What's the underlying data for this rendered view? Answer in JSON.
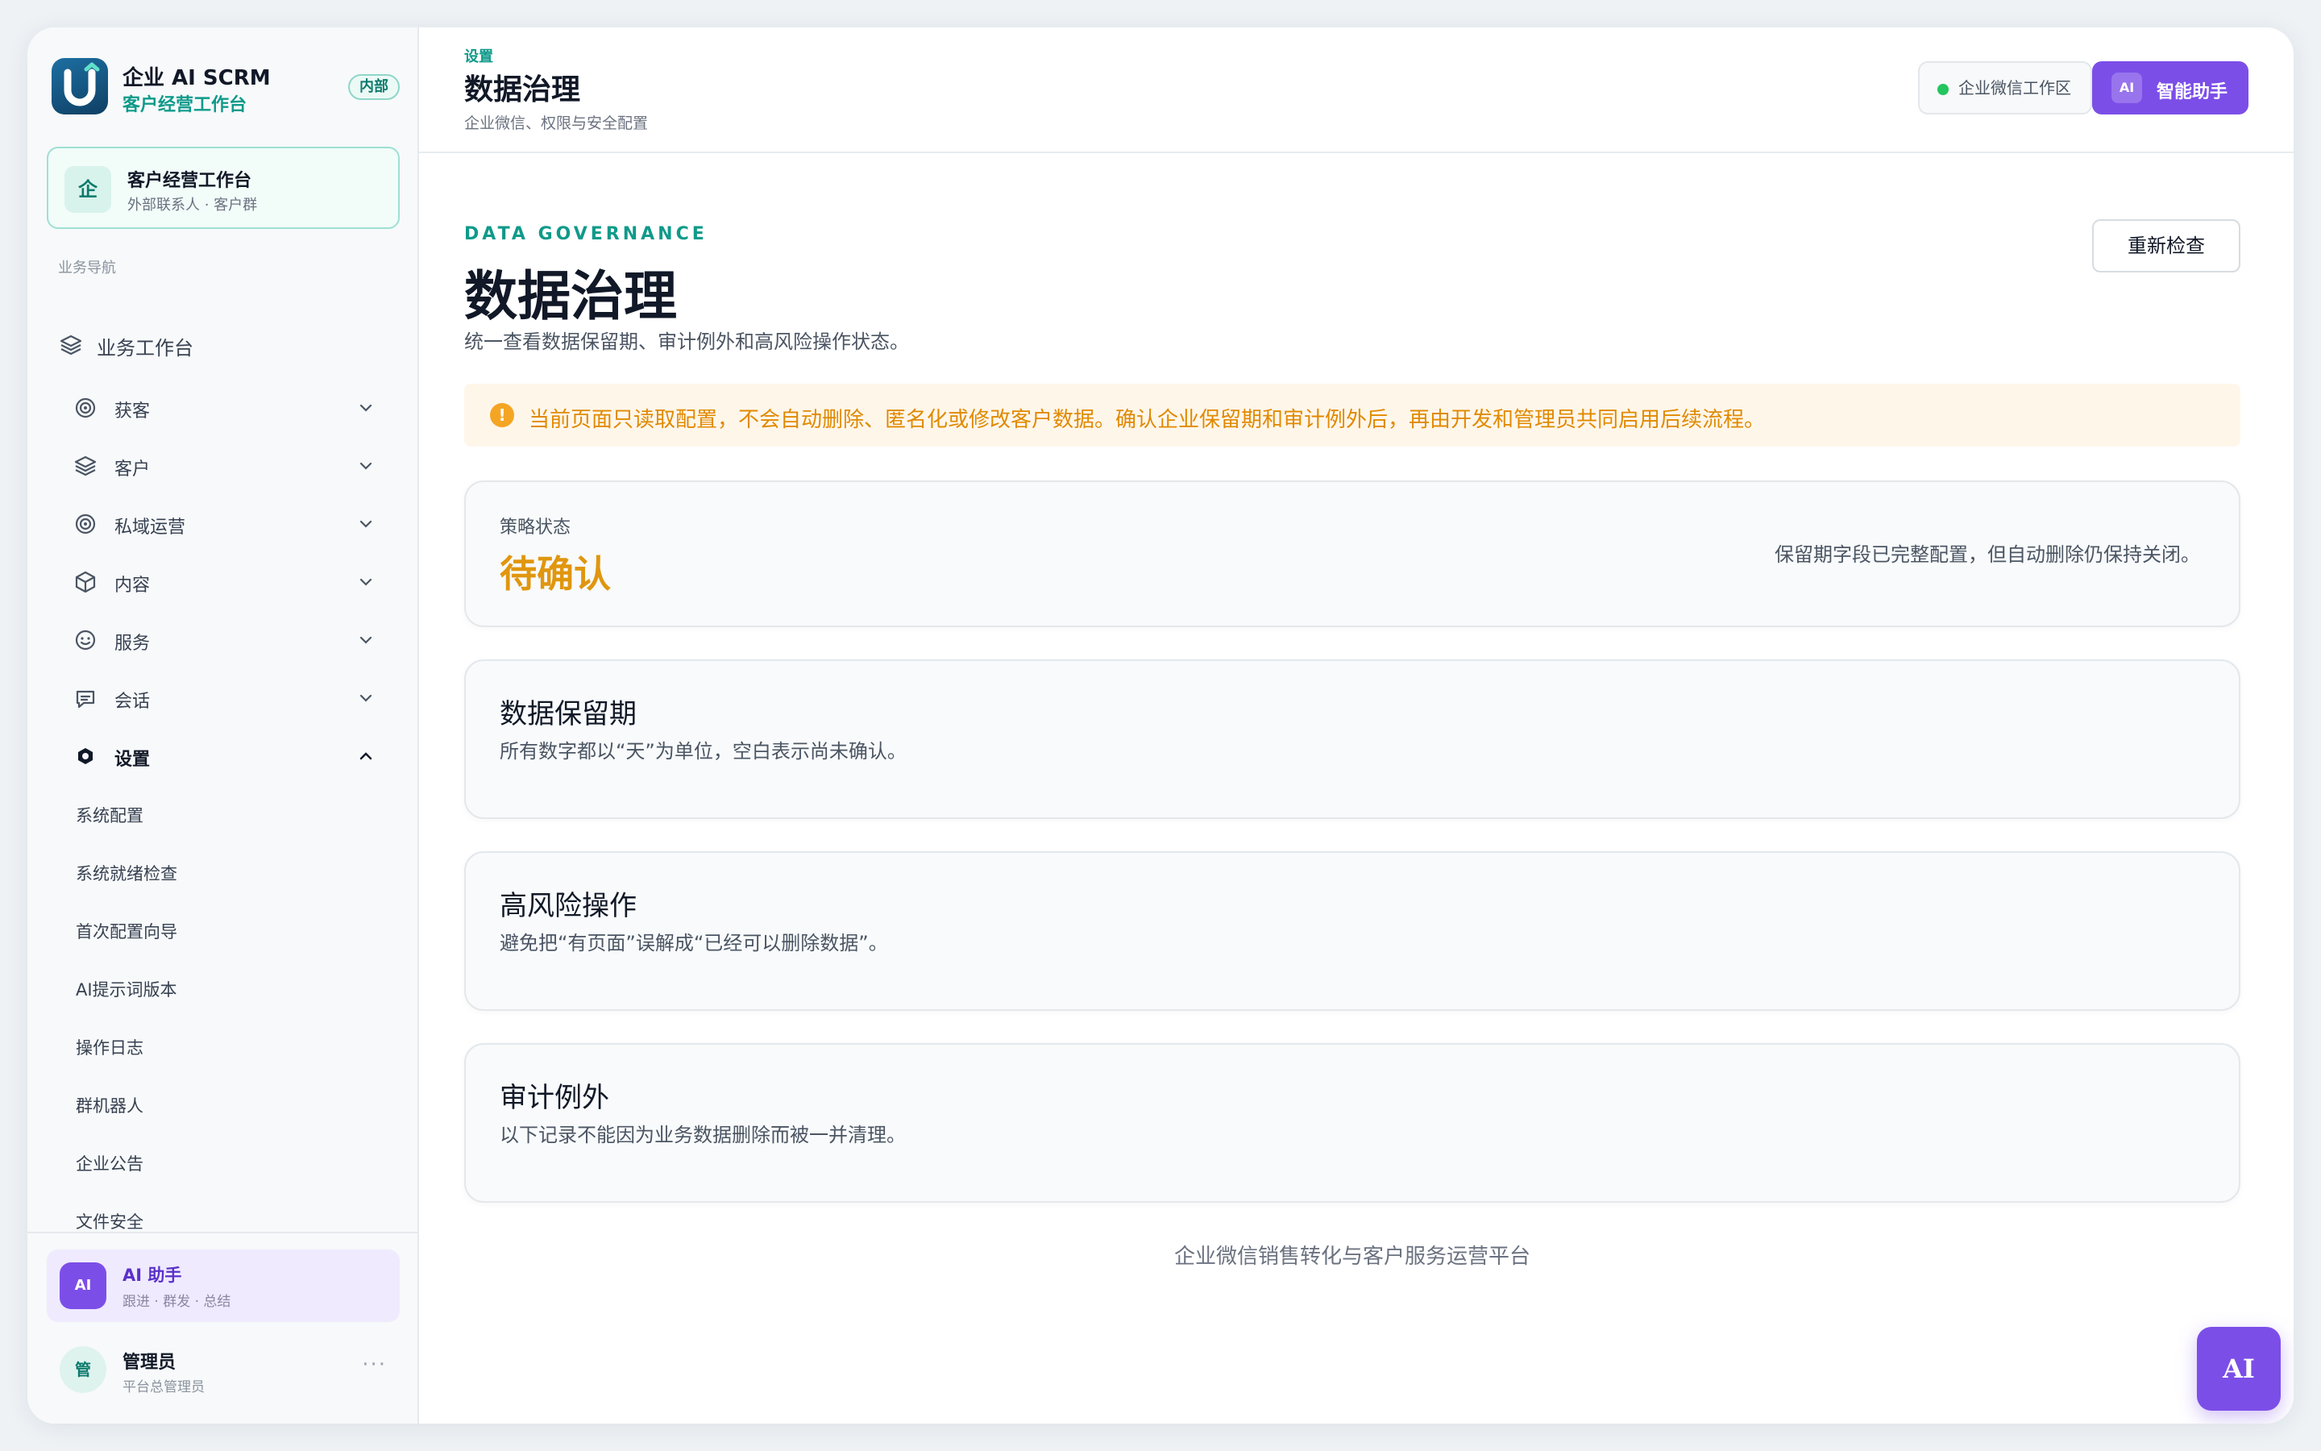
{
  "brand": {
    "name": "企业 AI SCRM",
    "subtitle": "客户经营工作台",
    "badge": "内部"
  },
  "workspace": {
    "icon_char": "企",
    "title": "客户经营工作台",
    "subtitle": "外部联系人 · 客户群"
  },
  "sidebar": {
    "section_label": "业务导航",
    "top_item": {
      "label": "业务工作台",
      "icon": "layers-icon"
    },
    "items": [
      {
        "label": "获客",
        "icon": "target-icon",
        "expanded": false
      },
      {
        "label": "客户",
        "icon": "layers-icon",
        "expanded": false
      },
      {
        "label": "私域运营",
        "icon": "target-icon",
        "expanded": false
      },
      {
        "label": "内容",
        "icon": "box-icon",
        "expanded": false
      },
      {
        "label": "服务",
        "icon": "smile-icon",
        "expanded": false
      },
      {
        "label": "会话",
        "icon": "chat-icon",
        "expanded": false
      },
      {
        "label": "设置",
        "icon": "settings-icon",
        "expanded": true
      }
    ],
    "settings_subitems": [
      "系统配置",
      "系统就绪检查",
      "首次配置向导",
      "AI提示词版本",
      "操作日志",
      "群机器人",
      "企业公告",
      "文件安全"
    ]
  },
  "ai_card": {
    "avatar": "AI",
    "title": "AI 助手",
    "subtitle": "跟进 · 群发 · 总结"
  },
  "user": {
    "avatar": "管",
    "name": "管理员",
    "role": "平台总管理员",
    "more": "···"
  },
  "topbar": {
    "breadcrumb": "设置",
    "title": "数据治理",
    "subtitle": "企业微信、权限与安全配置",
    "workspace_pill": "企业微信工作区",
    "assistant_button": {
      "tag": "AI",
      "label": "智能助手"
    }
  },
  "page": {
    "eyebrow": "DATA GOVERNANCE",
    "title": "数据治理",
    "description": "统一查看数据保留期、审计例外和高风险操作状态。",
    "recheck_button": "重新检查",
    "alert": "当前页面只读取配置，不会自动删除、匿名化或修改客户数据。确认企业保留期和审计例外后，再由开发和管理员共同启用后续流程。",
    "status": {
      "label": "策略状态",
      "value": "待确认",
      "note": "保留期字段已完整配置，但自动删除仍保持关闭。"
    },
    "sections": [
      {
        "title": "数据保留期",
        "description": "所有数字都以“天”为单位，空白表示尚未确认。"
      },
      {
        "title": "高风险操作",
        "description": "避免把“有页面”误解成“已经可以删除数据”。"
      },
      {
        "title": "审计例外",
        "description": "以下记录不能因为业务数据删除而被一并清理。"
      }
    ],
    "footer": "企业微信销售转化与客户服务运营平台"
  },
  "floating_ai": "AI",
  "colors": {
    "accent_teal": "#0f9a8a",
    "accent_purple": "#7c4ee8",
    "warning": "#e08a00",
    "status_pending": "#e0960f"
  }
}
